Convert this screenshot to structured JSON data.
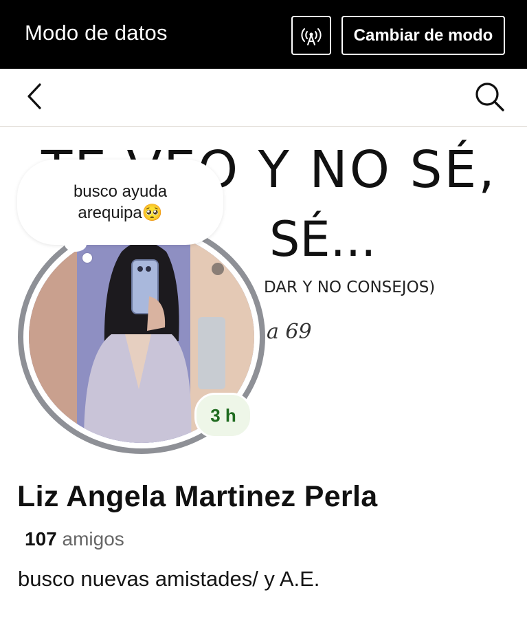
{
  "topbar": {
    "title": "Modo de datos",
    "switch_mode_label": "Cambiar de modo",
    "signal_icon": "broadcast-antenna-icon"
  },
  "navbar": {
    "back_icon": "chevron-left-icon",
    "search_icon": "search-icon"
  },
  "cover": {
    "line1": "TE VEO Y NO SÉ,",
    "line2": "SÉ...",
    "line3": "DAR Y NO CONSEJOS)",
    "line4": "a 69"
  },
  "note": {
    "line1": "busco ayuda",
    "line2": "arequipa🥺"
  },
  "profile": {
    "time_badge": "3 h",
    "name": "Liz Angela Martinez Perla",
    "friends_count": "107",
    "friends_label": "amigos",
    "bio": "busco nuevas amistades/ y A.E."
  },
  "colors": {
    "topbar_bg": "#000000",
    "badge_text": "#1f6b1f",
    "avatar_ring": "#8e9096"
  }
}
